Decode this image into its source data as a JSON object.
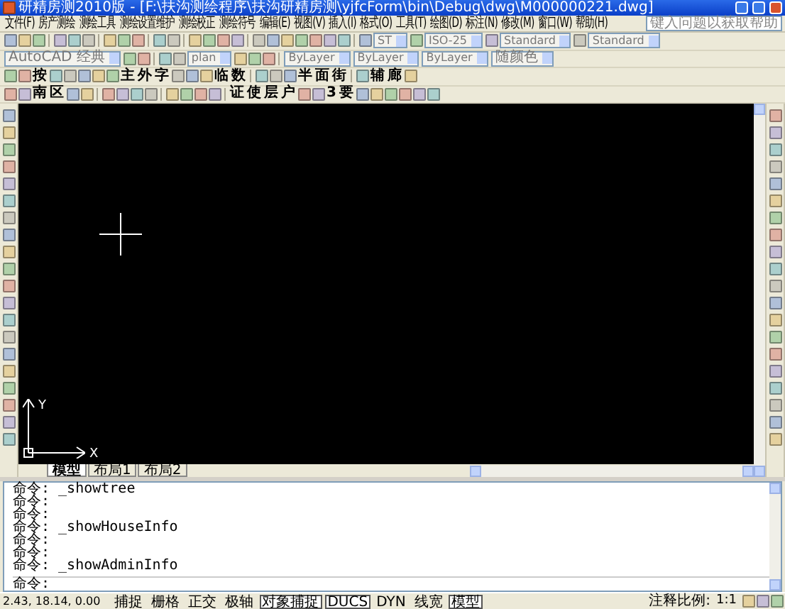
{
  "window": {
    "title": "研精房测2010版 - [F:\\扶沟测绘程序\\扶沟研精房测\\yjfcForm\\bin\\Debug\\dwg\\M000000221.dwg]"
  },
  "menu": [
    "文件(F)",
    "房产测绘",
    "测绘工具",
    "测绘设置维护",
    "测绘校正",
    "测绘符号",
    "编辑(E)",
    "视图(V)",
    "插入(I)",
    "格式(O)",
    "工具(T)",
    "绘图(D)",
    "标注(N)",
    "修改(M)",
    "窗口(W)",
    "帮助(H)"
  ],
  "help_search": {
    "placeholder": "键入问题以获取帮助"
  },
  "toolbar_rows": [
    {
      "items": [
        {
          "kind": "icon"
        },
        {
          "kind": "icon"
        },
        {
          "kind": "icon"
        },
        {
          "kind": "sep"
        },
        {
          "kind": "icon"
        },
        {
          "kind": "icon"
        },
        {
          "kind": "icon"
        },
        {
          "kind": "sep"
        },
        {
          "kind": "icon"
        },
        {
          "kind": "icon"
        },
        {
          "kind": "icon"
        },
        {
          "kind": "sep"
        },
        {
          "kind": "icon"
        },
        {
          "kind": "icon"
        },
        {
          "kind": "sep"
        },
        {
          "kind": "icon"
        },
        {
          "kind": "icon"
        },
        {
          "kind": "icon"
        },
        {
          "kind": "icon"
        },
        {
          "kind": "sep"
        },
        {
          "kind": "icon"
        },
        {
          "kind": "icon"
        },
        {
          "kind": "icon"
        },
        {
          "kind": "icon"
        },
        {
          "kind": "icon"
        },
        {
          "kind": "icon"
        },
        {
          "kind": "icon"
        },
        {
          "kind": "sep"
        },
        {
          "kind": "icon"
        },
        {
          "kind": "combo",
          "value": "ST"
        },
        {
          "kind": "icon"
        },
        {
          "kind": "combo",
          "value": "ISO-25"
        },
        {
          "kind": "icon"
        },
        {
          "kind": "combo",
          "value": "Standard"
        },
        {
          "kind": "icon"
        },
        {
          "kind": "combo",
          "value": "Standard"
        }
      ]
    },
    {
      "items": [
        {
          "kind": "combo",
          "value": "AutoCAD 经典"
        },
        {
          "kind": "icon"
        },
        {
          "kind": "icon"
        },
        {
          "kind": "sep"
        },
        {
          "kind": "icon"
        },
        {
          "kind": "icon"
        },
        {
          "kind": "combo",
          "value": "plan"
        },
        {
          "kind": "icon"
        },
        {
          "kind": "icon"
        },
        {
          "kind": "icon"
        },
        {
          "kind": "sep"
        },
        {
          "kind": "combo",
          "value": "ByLayer"
        },
        {
          "kind": "combo",
          "value": "ByLayer"
        },
        {
          "kind": "combo",
          "value": "ByLayer"
        },
        {
          "kind": "combo",
          "value": "随颜色"
        }
      ]
    },
    {
      "items": [
        {
          "kind": "icon"
        },
        {
          "kind": "icon"
        },
        {
          "kind": "text",
          "label": "按"
        },
        {
          "kind": "icon"
        },
        {
          "kind": "icon"
        },
        {
          "kind": "icon"
        },
        {
          "kind": "icon"
        },
        {
          "kind": "icon"
        },
        {
          "kind": "text",
          "label": "主"
        },
        {
          "kind": "text",
          "label": "外"
        },
        {
          "kind": "text",
          "label": "字"
        },
        {
          "kind": "icon"
        },
        {
          "kind": "icon"
        },
        {
          "kind": "icon"
        },
        {
          "kind": "text",
          "label": "临"
        },
        {
          "kind": "text",
          "label": "数"
        },
        {
          "kind": "sep"
        },
        {
          "kind": "icon"
        },
        {
          "kind": "icon"
        },
        {
          "kind": "icon"
        },
        {
          "kind": "text",
          "label": "半"
        },
        {
          "kind": "text",
          "label": "面"
        },
        {
          "kind": "text",
          "label": "街"
        },
        {
          "kind": "sep"
        },
        {
          "kind": "icon"
        },
        {
          "kind": "text",
          "label": "辅"
        },
        {
          "kind": "text",
          "label": "廊"
        },
        {
          "kind": "icon"
        }
      ]
    },
    {
      "items": [
        {
          "kind": "icon"
        },
        {
          "kind": "icon"
        },
        {
          "kind": "text",
          "label": "南"
        },
        {
          "kind": "text",
          "label": "区"
        },
        {
          "kind": "icon"
        },
        {
          "kind": "icon"
        },
        {
          "kind": "sep"
        },
        {
          "kind": "icon"
        },
        {
          "kind": "icon"
        },
        {
          "kind": "icon"
        },
        {
          "kind": "icon"
        },
        {
          "kind": "sep"
        },
        {
          "kind": "icon"
        },
        {
          "kind": "icon"
        },
        {
          "kind": "icon"
        },
        {
          "kind": "icon"
        },
        {
          "kind": "sep"
        },
        {
          "kind": "text",
          "label": "证"
        },
        {
          "kind": "text",
          "label": "使"
        },
        {
          "kind": "text",
          "label": "层"
        },
        {
          "kind": "text",
          "label": "户"
        },
        {
          "kind": "icon"
        },
        {
          "kind": "icon"
        },
        {
          "kind": "text",
          "label": "3"
        },
        {
          "kind": "text",
          "label": "要"
        },
        {
          "kind": "icon"
        },
        {
          "kind": "icon"
        },
        {
          "kind": "icon"
        },
        {
          "kind": "icon"
        },
        {
          "kind": "icon"
        },
        {
          "kind": "icon"
        }
      ]
    }
  ],
  "ucs": {
    "x_label": "X",
    "y_label": "Y"
  },
  "layout_tabs": [
    {
      "label": "模型",
      "selected": true
    },
    {
      "label": "布局1",
      "selected": false
    },
    {
      "label": "布局2",
      "selected": false
    }
  ],
  "command_history": [
    "命令: _showtree",
    "命令:",
    "命令:",
    "命令: _showHouseInfo",
    "命令:",
    "命令:",
    "命令: _showAdminInfo"
  ],
  "command_prompt": "命令:",
  "status_bar": {
    "coordinates": "2.43, 18.14, 0.00",
    "toggles": [
      {
        "label": "捕捉",
        "on": false
      },
      {
        "label": "栅格",
        "on": false
      },
      {
        "label": "正交",
        "on": false
      },
      {
        "label": "极轴",
        "on": false
      },
      {
        "label": "对象捕捉",
        "on": true
      },
      {
        "label": "DUCS",
        "on": true
      },
      {
        "label": "DYN",
        "on": false
      },
      {
        "label": "线宽",
        "on": false
      },
      {
        "label": "模型",
        "on": true
      }
    ],
    "annotation_scale_label": "注释比例:",
    "annotation_scale": "1:1"
  }
}
